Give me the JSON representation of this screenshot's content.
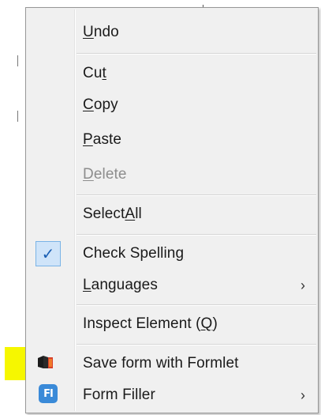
{
  "context_menu": {
    "items": [
      {
        "label": "Undo",
        "mnemonic_index": 0
      },
      {
        "label": "Cut",
        "mnemonic_index": 2
      },
      {
        "label": "Copy",
        "mnemonic_index": 0
      },
      {
        "label": "Paste",
        "mnemonic_index": 0
      },
      {
        "label": "Delete",
        "mnemonic_index": 0,
        "disabled": true
      },
      {
        "label": "Select All",
        "mnemonic_index": 7
      },
      {
        "label": "Check Spelling",
        "mnemonic_index": 13,
        "checked": true
      },
      {
        "label": "Languages",
        "mnemonic_index": 0,
        "submenu": true
      },
      {
        "label": "Inspect Element (Q)",
        "mnemonic_index": 17
      },
      {
        "label": "Save form with Formlet",
        "icon": "formlet-icon"
      },
      {
        "label": "Form Filler",
        "icon": "form-filler-icon",
        "submenu": true
      }
    ],
    "check_glyph": "✓",
    "submenu_glyph": "›",
    "form_filler_icon_text": "FI",
    "colors": {
      "highlight": "#f6f700",
      "check_bg": "#cfe4f9",
      "check_border": "#7ab3e6",
      "menu_bg": "#f0f0f0"
    }
  }
}
